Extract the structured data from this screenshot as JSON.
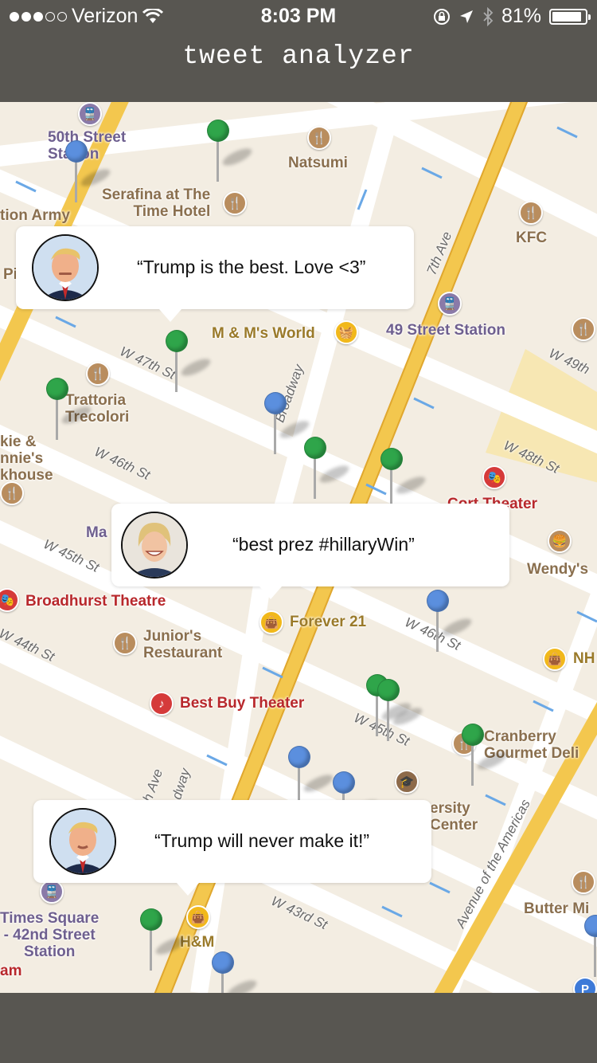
{
  "status_bar": {
    "carrier": "Verizon",
    "time": "8:03 PM",
    "battery": "81%",
    "battery_level": 0.81,
    "signal_icon": "signal-dots-icon",
    "wifi_icon": "wifi-icon",
    "lock_icon": "rotation-lock-icon",
    "location_icon": "location-arrow-icon",
    "bluetooth_icon": "bluetooth-icon"
  },
  "header": {
    "title": "tweet analyzer"
  },
  "tweets": [
    {
      "text": "“Trump is the best. Love <3”",
      "avatar": "trump-avatar"
    },
    {
      "text": "“best prez #hillaryWin”",
      "avatar": "hillary-avatar"
    },
    {
      "text": "“Trump will never make it!”",
      "avatar": "trump-avatar"
    }
  ],
  "map": {
    "places": {
      "fifty_street_station": "50th Street\nStation",
      "natsumi": "Natsumi",
      "serafina": "Serafina at The\nTime Hotel",
      "salvation_army": "tion Army",
      "kfc": "KFC",
      "mm_world": "M & M's World",
      "forty_nine_station": "49 Street Station",
      "trattoria": "Trattoria\nTrecolori",
      "steakhouse": "kie &\nnnie's\nkhouse",
      "cort_theater": "Cort Theater",
      "wendys": "Wendy's",
      "broadhurst": "Broadhurst Theatre",
      "forever21": "Forever 21",
      "juniors": "Junior's\nRestaurant",
      "nh": "NH",
      "best_buy_theater": "Best Buy Theater",
      "cranberry": "Cranberry\nGourmet Deli",
      "university_center": "ersity\nCenter",
      "times_square": "Times Square\n- 42nd Street\nStation",
      "hm": "H&M",
      "butter": "Butter Mi",
      "am": "am",
      "pi": "Pi",
      "ma": "Ma"
    },
    "streets": {
      "w47": "W 47th St",
      "w46": "W 46th St",
      "w45": "W 45th St",
      "w44": "W 44th St",
      "w48": "W 48th St",
      "w49": "W 49th",
      "w46b": "W 46th St",
      "w45b": "W 45th St",
      "w43": "W 43rd St",
      "broadway": "Broadway",
      "seventh_ave": "7th Ave",
      "avenue_americas": "Avenue of the Americas",
      "broadway2": "dway",
      "seventh2": "th Ave"
    },
    "parking": "P"
  },
  "colors": {
    "header_bg": "#585651",
    "map_bg": "#f3ede2",
    "pin_green": "#2fa54a",
    "pin_blue": "#5b8fde"
  }
}
